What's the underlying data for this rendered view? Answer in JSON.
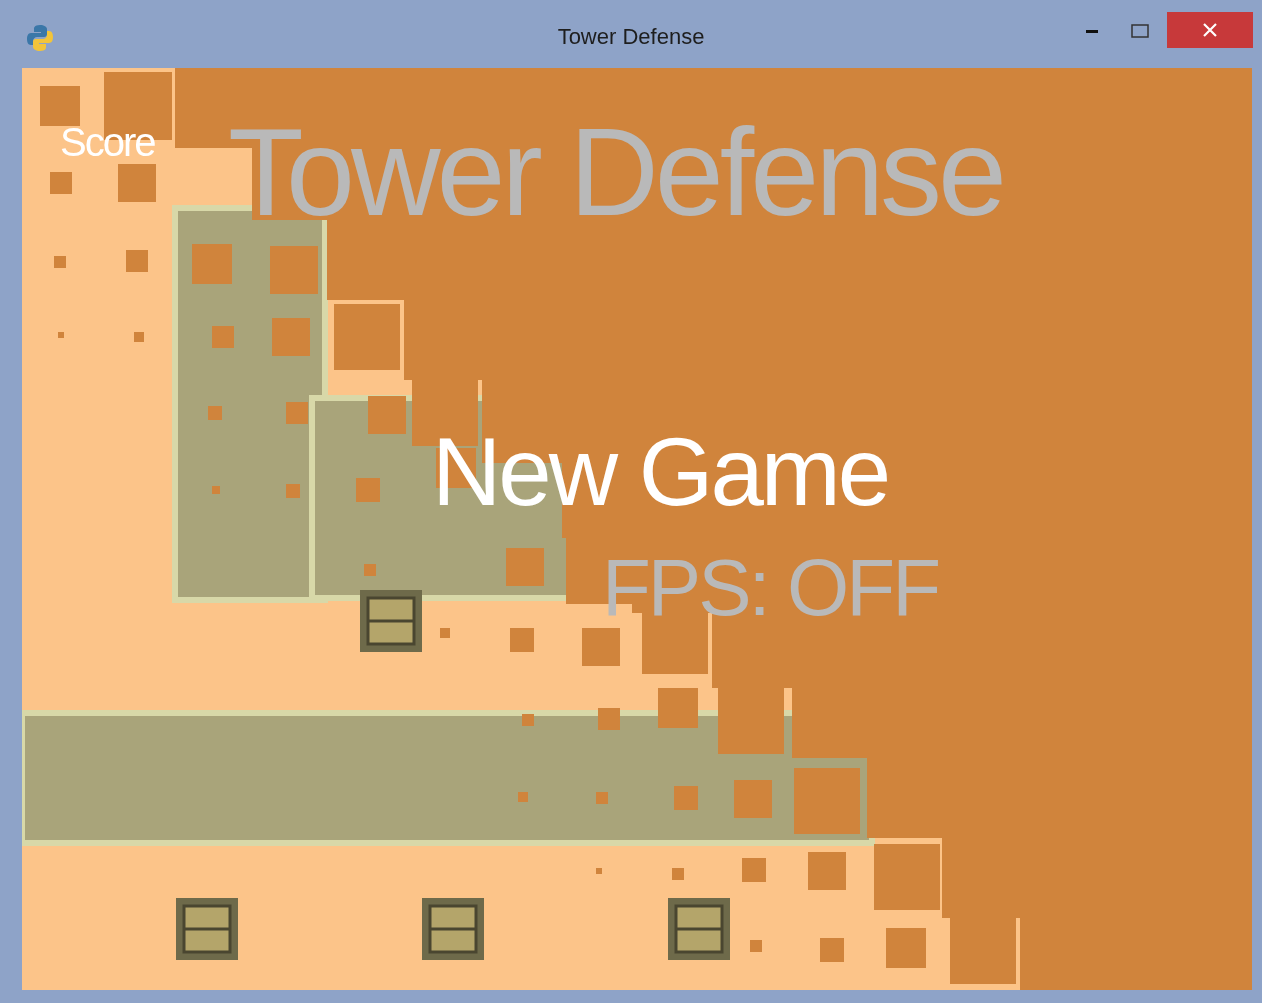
{
  "window": {
    "title": "Tower Defense"
  },
  "hud": {
    "score_label": "Score"
  },
  "game_title": "Tower Defense",
  "menu": [
    {
      "label": "New Game",
      "selected": true
    },
    {
      "label": "FPS: OFF",
      "selected": false
    }
  ]
}
